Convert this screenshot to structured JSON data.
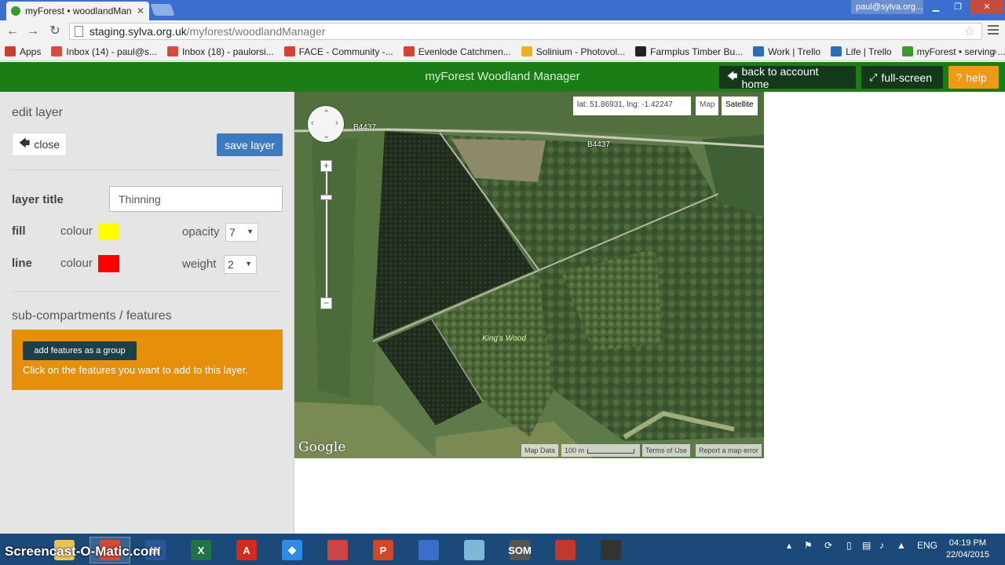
{
  "browser": {
    "tab_title": "myForest • woodlandMan",
    "account": "paul@sylva.org...",
    "url_host": "staging.sylva.org.uk",
    "url_path": "/myforest/woodlandManager",
    "bookmarks": [
      {
        "label": "Apps",
        "icon": "apps-grid-icon",
        "color": "#c8402e"
      },
      {
        "label": "Inbox (14) - paul@s...",
        "icon": "gmail-icon",
        "color": "#d54b3d"
      },
      {
        "label": "Inbox (18) - paulorsi...",
        "icon": "gmail-icon",
        "color": "#d54b3d"
      },
      {
        "label": "FACE - Community -...",
        "icon": "face-icon",
        "color": "#d5442f"
      },
      {
        "label": "Evenlode Catchmen...",
        "icon": "evenlode-icon",
        "color": "#d5442f"
      },
      {
        "label": "Solinium - Photovol...",
        "icon": "sun-icon",
        "color": "#f0b020"
      },
      {
        "label": "Farmplus Timber Bu...",
        "icon": "letter-f-icon",
        "color": "#222222"
      },
      {
        "label": "Work | Trello",
        "icon": "trello-icon",
        "color": "#2a6fb5"
      },
      {
        "label": "Life | Trello",
        "icon": "trello-icon",
        "color": "#2a6fb5"
      },
      {
        "label": "myForest • serving ...",
        "icon": "tree-icon",
        "color": "#3c9a2d"
      }
    ],
    "more": "»"
  },
  "header": {
    "title": "myForest Woodland Manager",
    "back_label": "back to account home",
    "fullscreen_label": "full-screen",
    "help_label": "help",
    "bar_color": "#1a7d15"
  },
  "panel": {
    "title": "edit layer",
    "close_label": "close",
    "save_label": "save layer",
    "layer_title_label": "layer title",
    "layer_title_value": "Thinning",
    "fill_label": "fill",
    "fill_colour_label": "colour",
    "fill_colour": "#ffff00",
    "opacity_label": "opacity",
    "opacity_value": "7",
    "line_label": "line",
    "line_colour_label": "colour",
    "line_colour": "#ff0000",
    "weight_label": "weight",
    "weight_value": "2",
    "section_title": "sub-compartments / features",
    "group_button_label": "add features as a group",
    "group_hint": "Click on the features you want to add to this layer."
  },
  "map": {
    "coords": "lat: 51.86931, lng: -1.42247",
    "type_map": "Map",
    "type_satellite": "Satellite",
    "road_label_1": "B4437",
    "road_label_2": "B4437",
    "wood_label": "King's Wood",
    "logo": "Google",
    "map_data": "Map Data",
    "scale": "100 m",
    "terms": "Terms of Use",
    "report": "Report a map error"
  },
  "watermark": "Screencast-O-Matic.com",
  "taskbar": {
    "apps": [
      {
        "icon": "explorer-folder-icon",
        "color": "#e8c25a",
        "glyph": ""
      },
      {
        "icon": "chrome-icon",
        "color": "#d64937",
        "glyph": ""
      },
      {
        "icon": "word-icon",
        "color": "#2b579a",
        "glyph": "W"
      },
      {
        "icon": "excel-icon",
        "color": "#217346",
        "glyph": "X"
      },
      {
        "icon": "acrobat-icon",
        "color": "#d22a1e",
        "glyph": "A"
      },
      {
        "icon": "dropbox-icon",
        "color": "#2e8ce6",
        "glyph": "◆"
      },
      {
        "icon": "paint-icon",
        "color": "#cc4444",
        "glyph": ""
      },
      {
        "icon": "powerpoint-icon",
        "color": "#d24726",
        "glyph": "P"
      },
      {
        "icon": "google-earth-icon",
        "color": "#3a6fc9",
        "glyph": ""
      },
      {
        "icon": "notepad-icon",
        "color": "#7fb6d8",
        "glyph": ""
      },
      {
        "icon": "som-icon",
        "color": "#555555",
        "glyph": "SOM"
      },
      {
        "icon": "snipping-tool-icon",
        "color": "#c0392b",
        "glyph": ""
      },
      {
        "icon": "screen-capture-icon",
        "color": "#333333",
        "glyph": ""
      }
    ],
    "language": "ENG",
    "time": "04:19 PM",
    "date": "22/04/2015"
  }
}
